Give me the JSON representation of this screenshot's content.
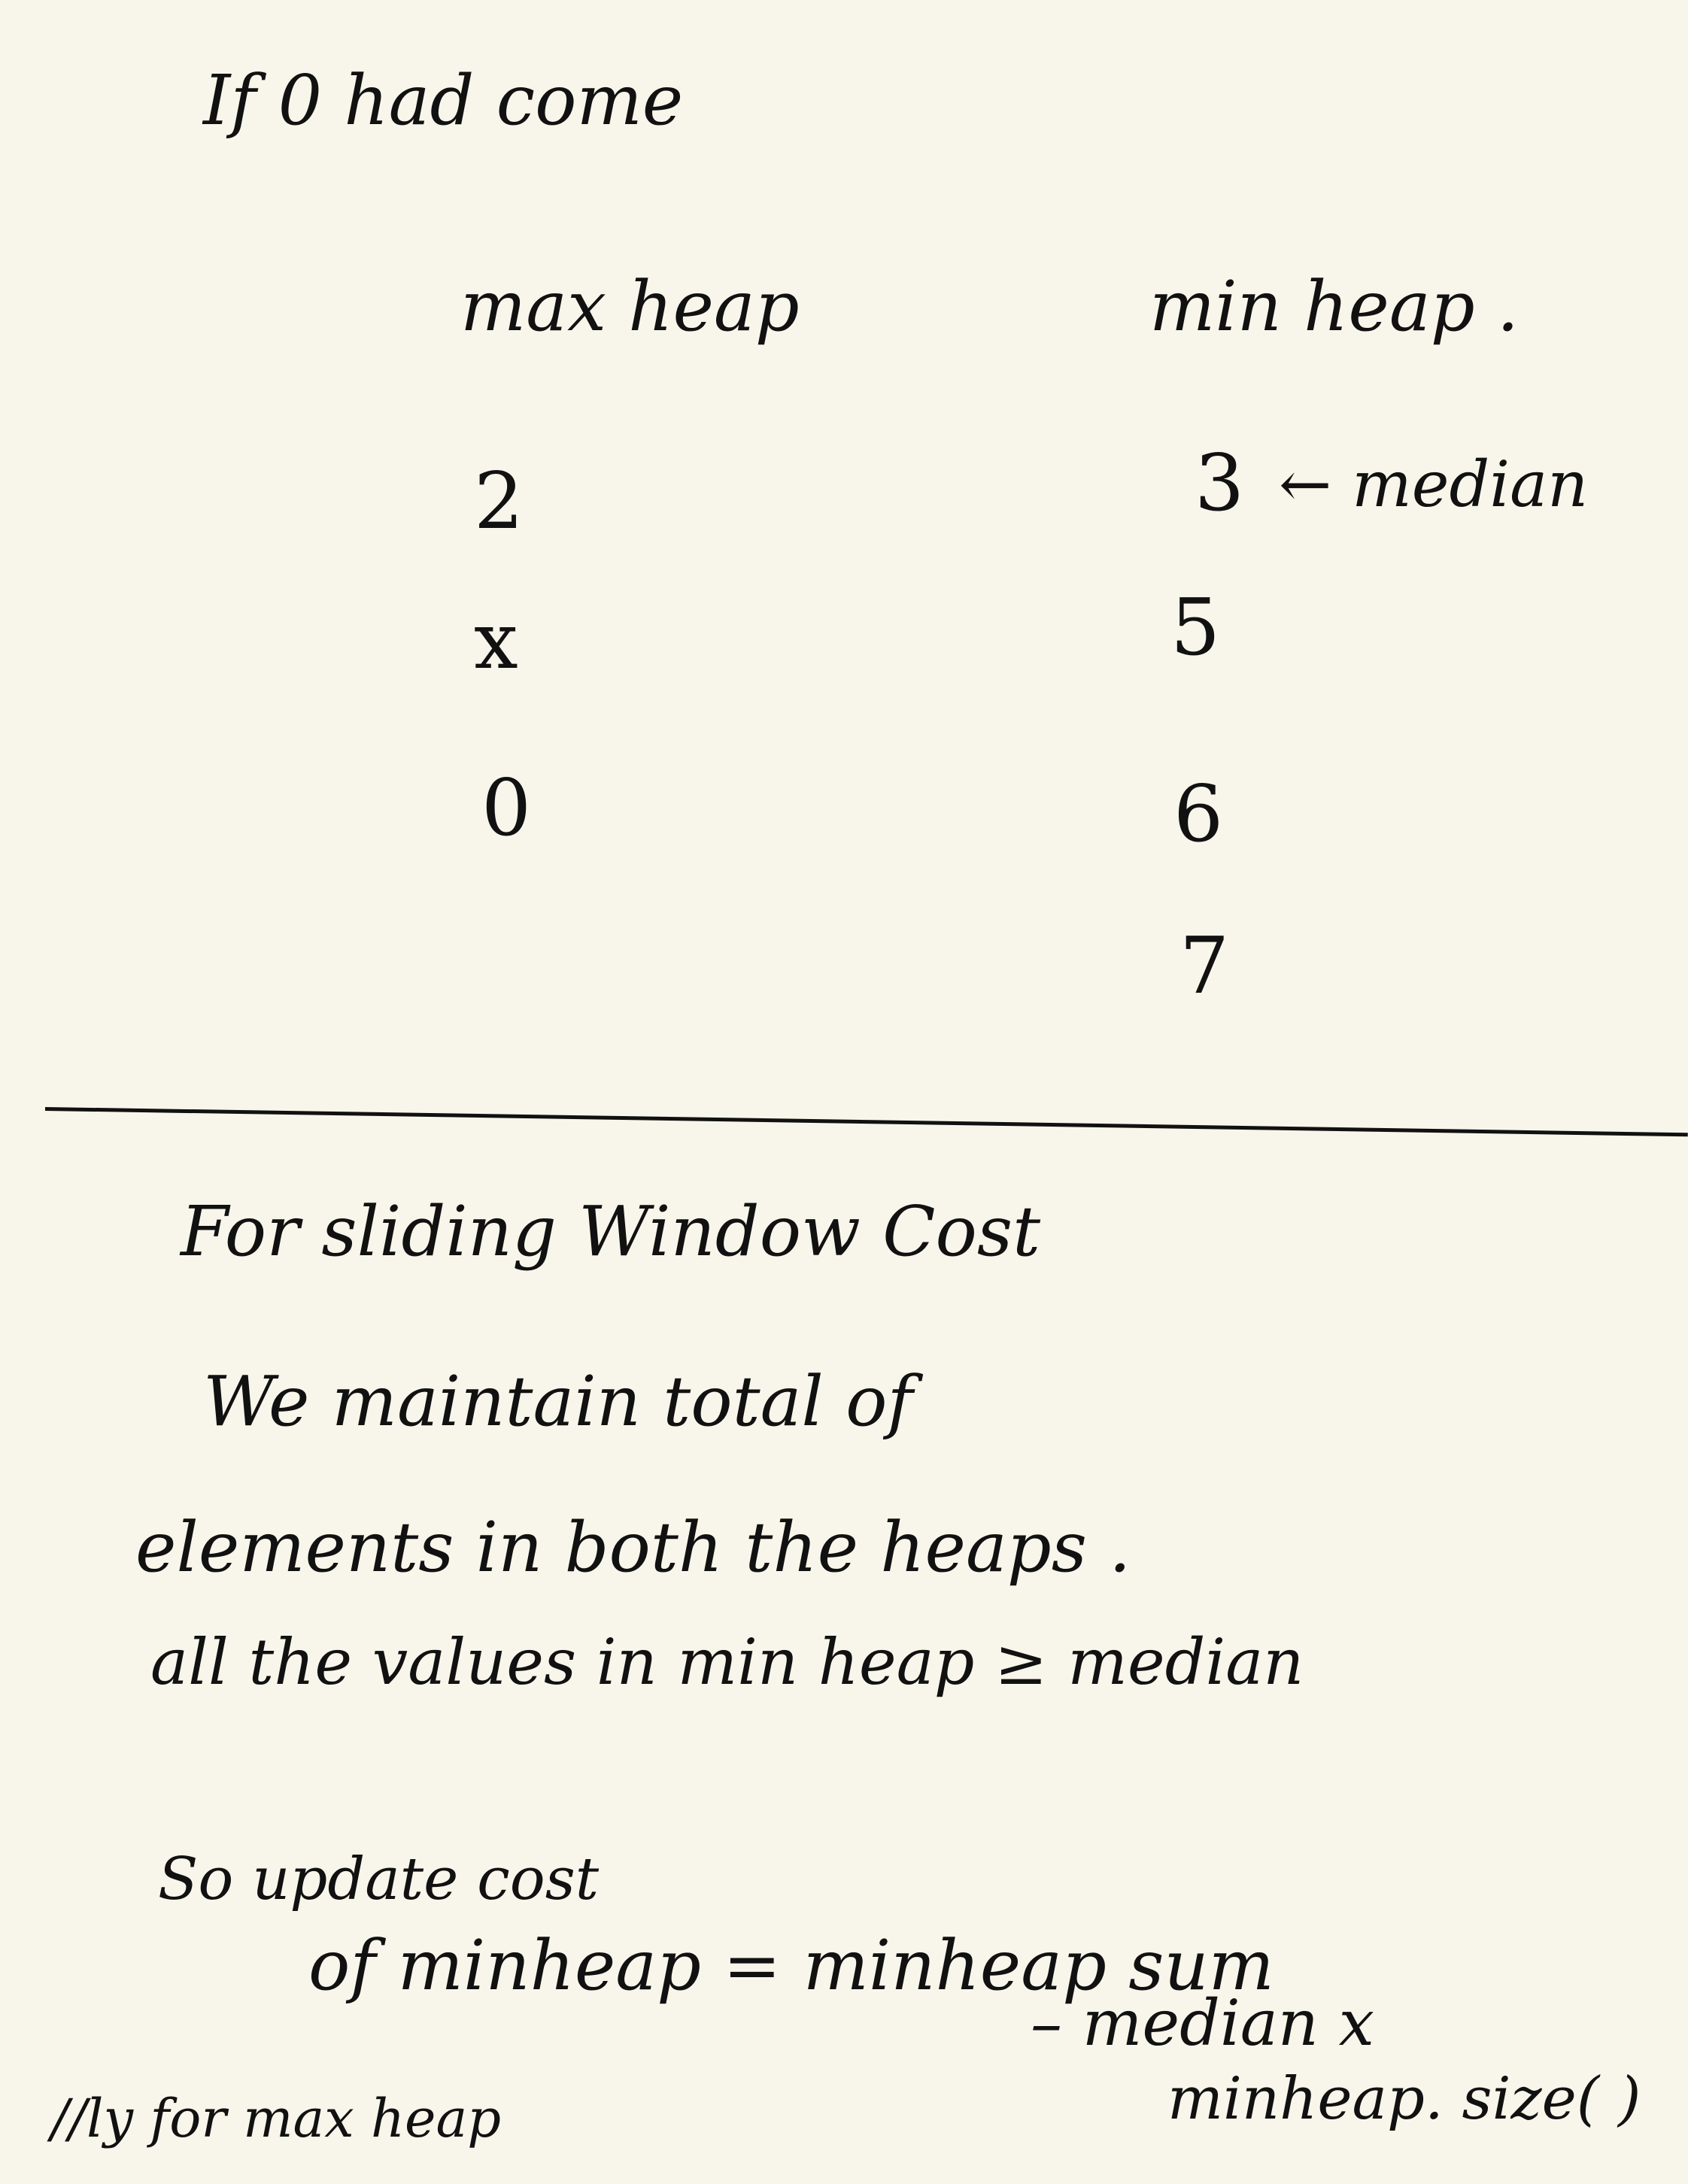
{
  "note": {
    "heading": "If 0 had come",
    "columns": {
      "max_heap_label": "max heap",
      "min_heap_label": "min heap ."
    },
    "max_heap_values": {
      "first": "2",
      "removed": "x",
      "last": "0"
    },
    "min_heap_values": {
      "first": "3",
      "median_marker": "← median",
      "second": "5",
      "third": "6",
      "fourth": "7"
    },
    "section2": {
      "title": "For sliding Window Cost",
      "line1": "We   maintain  total  of",
      "line2": "elements  in  both  the  heaps .",
      "line3": "all  the  values   in   min heap ≥ median",
      "line4": "So update cost",
      "line5": "of  minheap  =  minheap sum",
      "line6": "–  median x",
      "line7": "minheap. size( )",
      "line8": "//ly  for  max heap"
    }
  }
}
